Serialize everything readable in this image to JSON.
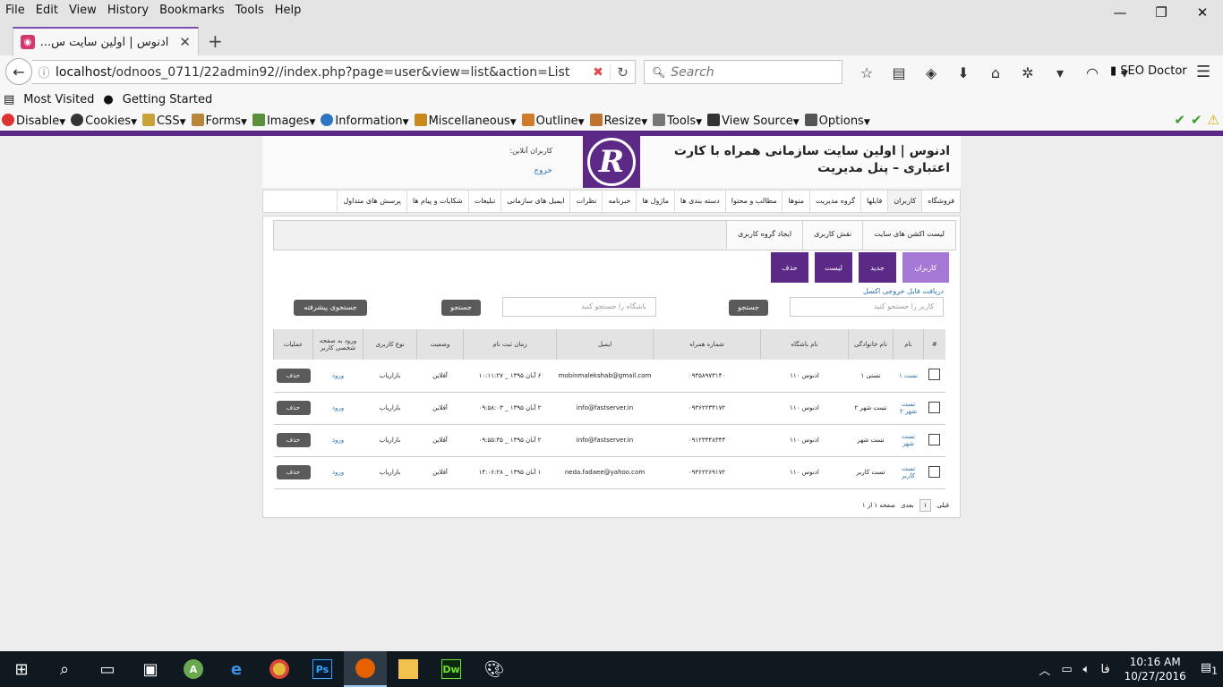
{
  "browser": {
    "menu": [
      "File",
      "Edit",
      "View",
      "History",
      "Bookmarks",
      "Tools",
      "Help"
    ],
    "tab_title": "ادنوس | اولین سایت س...",
    "url_host": "localhost",
    "url_path": "/odnoos_0711/22admin92//index.php?page=user&view=list&action=List",
    "search_placeholder": "Search",
    "seo_doctor": "SEO Doctor",
    "bookmarks": [
      "Most Visited",
      "Getting Started"
    ],
    "devtools": [
      "Disable",
      "Cookies",
      "CSS",
      "Forms",
      "Images",
      "Information",
      "Miscellaneous",
      "Outline",
      "Resize",
      "Tools",
      "View Source",
      "Options"
    ]
  },
  "header": {
    "title_line1": "ادنوس | اولین سایت سازمانی همراه با کارت",
    "title_line2": "اعتباری – پنل مدیریت",
    "online_label": "کاربران آنلاین:",
    "logout": "خروج",
    "logo_letter": "R"
  },
  "main_nav": [
    "فروشگاه",
    "کاربران",
    "فایلها",
    "گروه مدیریت",
    "منوها",
    "مطالب و محتوا",
    "دسته بندی ها",
    "ماژول ها",
    "خبرنامه",
    "نظرات",
    "ایمیل های سازمانی",
    "تبلیغات",
    "شکایات و پیام ها",
    "پرسش های متداول"
  ],
  "sub_nav": [
    "لیست اکشن های سایت",
    "نقش کاربری",
    "ایجاد گروه کاربری"
  ],
  "action_buttons": [
    "کاربران",
    "جدید",
    "لیست",
    "حذف"
  ],
  "excel_link": "دریافت فایل خروجی اکسل",
  "search": {
    "user_placeholder": "کاربر را جستجو کنید",
    "club_placeholder": "باشگاه را جستجو کنید",
    "search_btn": "جستجو",
    "advanced_btn": "جستجوی پیشرفته"
  },
  "table": {
    "headers": [
      "#",
      "نام",
      "نام خانوادگی",
      "نام باشگاه",
      "شماره همراه",
      "ایمیل",
      "زمان ثبت نام",
      "وضعیت",
      "نوع کاربری",
      "ورود به صفحه شخصی کاربر",
      "عملیات"
    ],
    "rows": [
      {
        "name": "تست ۱",
        "family": "تستی ۱",
        "club": "ادنوس ۱۱۰",
        "mobile": "۰۹۳۵۸۹۷۳۱۴۰",
        "email": "mobinmalekshab@gmail.com",
        "time": "۶ آبان ۱۳۹۵ _ ۱۰:۱۱:۲۷",
        "status": "آفلاین",
        "type": "بازاریاب",
        "login": "ورود",
        "op": "حذف"
      },
      {
        "name": "تست شهر ۲",
        "family": "تست شهر ۲",
        "club": "ادنوس ۱۱۰",
        "mobile": "۰۹۳۶۲۲۳۴۱۷۲",
        "email": "info@fastserver.in",
        "time": "۲ آبان ۱۳۹۵ _ ۰۹:۵۸:۰۳",
        "status": "آفلاین",
        "type": "بازاریاب",
        "login": "ورود",
        "op": "حذف"
      },
      {
        "name": "تست شهر",
        "family": "تست شهر",
        "club": "ادنوس ۱۱۰",
        "mobile": "۰۹۱۲۳۳۴۸۳۴۳",
        "email": "info@fastserver.in",
        "time": "۲ آبان ۱۳۹۵ _ ۰۹:۵۵:۳۵",
        "status": "آفلاین",
        "type": "بازاریاب",
        "login": "ورود",
        "op": "حذف"
      },
      {
        "name": "تست کاربر",
        "family": "تست کاربر",
        "club": "ادنوس ۱۱۰",
        "mobile": "۰۹۳۶۲۲۶۹۱۷۲",
        "email": "neda.fadaee@yahoo.com",
        "time": "۱ آبان ۱۳۹۵ _ ۱۴:۰۶:۲۸",
        "status": "آفلاین",
        "type": "بازاریاب",
        "login": "ورود",
        "op": "حذف"
      }
    ]
  },
  "pager": {
    "prev": "قبلی",
    "page": "۱",
    "next": "بعدی",
    "info": "صفحه ۱ از ۱"
  },
  "taskbar": {
    "time": "10:16 AM",
    "date": "10/27/2016",
    "lang": "فا",
    "notif": "1"
  }
}
